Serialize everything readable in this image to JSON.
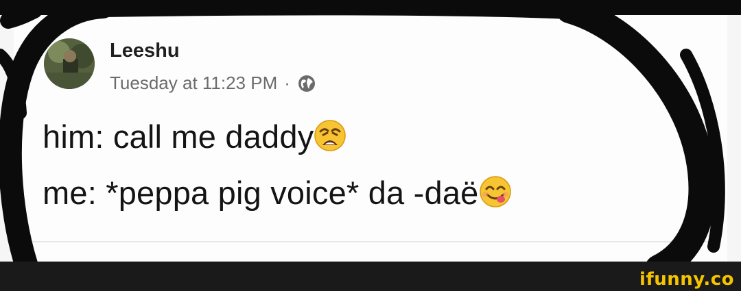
{
  "post": {
    "author": "Leeshu",
    "timestamp": "Tuesday at 11:23 PM",
    "separator": "·",
    "privacy_icon": "globe-icon",
    "lines": [
      {
        "text": "him: call me daddy",
        "emoji": "weary-face-emoji"
      },
      {
        "text": "me: *peppa pig voice* da -daë",
        "emoji": "smiling-face-savoring-food-emoji"
      }
    ]
  },
  "watermark": {
    "text": "ifunny.co"
  },
  "colors": {
    "scribble": "#0b0b0b",
    "accent": "#f5c400",
    "text": "#141414",
    "meta": "#6b6b6b"
  }
}
